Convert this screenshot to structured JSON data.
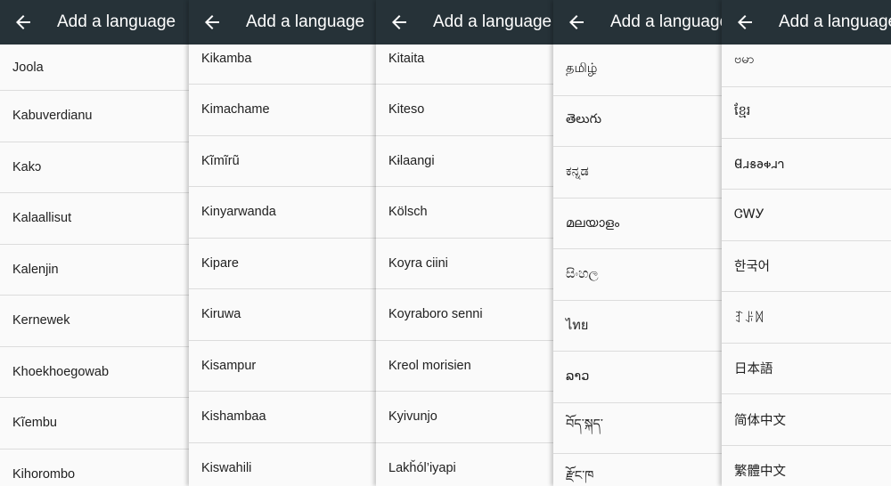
{
  "panels": [
    {
      "title": "Add a language",
      "items": [
        "Joola",
        "Kabuverdianu",
        "Kakɔ",
        "Kalaallisut",
        "Kalenjin",
        "Kernewek",
        "Khoekhoegowab",
        "Kĩembu",
        "Kihorombo"
      ]
    },
    {
      "title": "Add a language",
      "items": [
        "Kikamba",
        "Kimachame",
        "Kĩmĩrũ",
        "Kinyarwanda",
        "Kipare",
        "Kiruwa",
        "Kisampur",
        "Kishambaa",
        "Kiswahili"
      ]
    },
    {
      "title": "Add a language",
      "items": [
        "Kitaita",
        "Kiteso",
        "Kɨlaangi",
        "Kölsch",
        "Koyra ciini",
        "Koyraboro senni",
        "Kreol morisien",
        "Kyivunjo",
        "Lakȟól’iyapi"
      ]
    },
    {
      "title": "Add a language",
      "items": [
        "தமிழ்",
        "తెలుగు",
        "ಕನ್ನಡ",
        "മലയാളം",
        "සිංහල",
        "ไทย",
        "ລາວ",
        "བོད་སྐད་",
        "རྫོང་ཁ"
      ]
    },
    {
      "title": "Add a language",
      "items": [
        "ဗမာ",
        "ខ្មែរ",
        "𐐔𐐯𐑅𐐨𐑉𐐯𐐻",
        "ᏣᎳᎩ",
        "한국어",
        "ꆈꌠꉙ",
        "日本語",
        "简体中文",
        "繁體中文"
      ]
    }
  ],
  "icons": {
    "back": "arrow-back-icon"
  },
  "colors": {
    "appbar": "#263238",
    "list_bg": "#fafafa",
    "divider": "#dcdcdc",
    "text": "#212121"
  }
}
